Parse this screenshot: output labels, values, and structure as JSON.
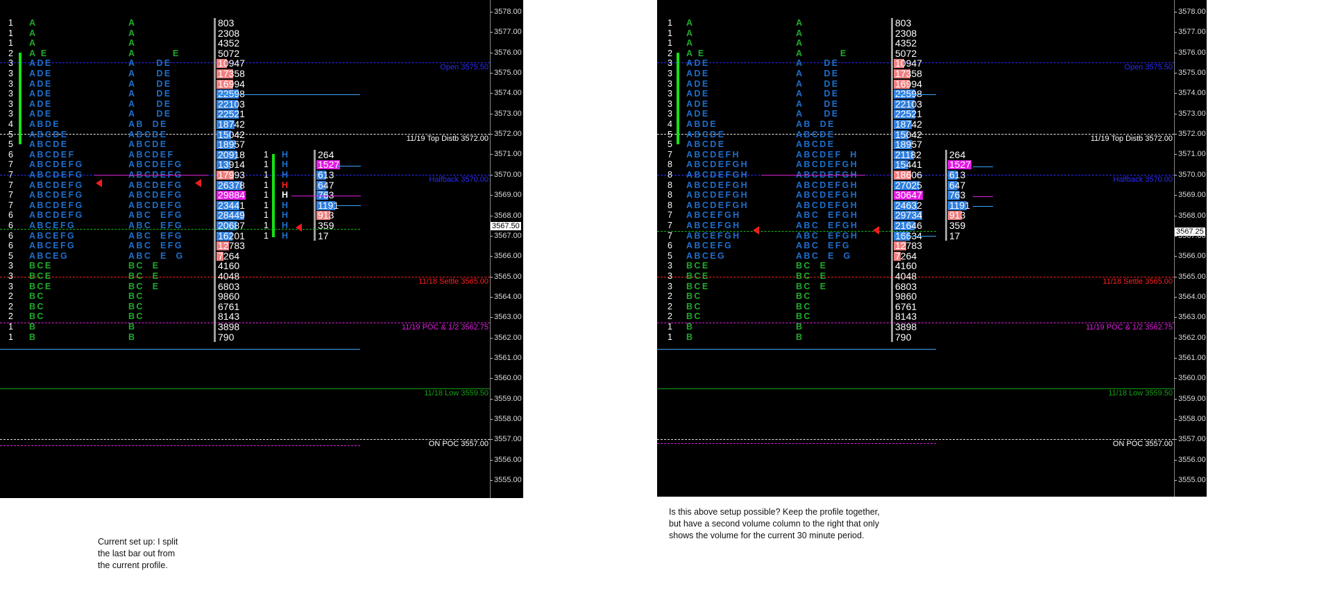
{
  "axis": {
    "labels": [
      "3578.00",
      "3577.00",
      "3576.00",
      "3575.00",
      "3574.00",
      "3573.00",
      "3572.00",
      "3571.00",
      "3570.00",
      "3569.00",
      "3568.00",
      "3567.00",
      "3566.00",
      "3565.00",
      "3564.00",
      "3563.00",
      "3562.00",
      "3561.00",
      "3560.00",
      "3559.00",
      "3558.00",
      "3557.00",
      "3556.00",
      "3555.00"
    ]
  },
  "levels": {
    "open": "Open  3575.50",
    "top_distb": "11/19 Top Distb  3572.00",
    "halfback": "Halfback  3570.00",
    "settle": "11/18 Settle  3565.00",
    "poc_half": "11/19 POC & 1/2  3562.75",
    "low": "11/18 Low  3559.50",
    "on_poc": "ON POC  3557.00"
  },
  "colors": {
    "bg": "#000000",
    "green_letters": "#1faa2a",
    "blue_letters": "#1e6fcc",
    "vol_blue": "#2f7fdf",
    "vol_salmon": "#f08080",
    "vol_magenta": "#e41ae4",
    "level_blue": "#2b2bff",
    "level_red": "#ff2020",
    "level_magenta": "#e020e0",
    "level_green": "#16a016"
  },
  "left": {
    "current_price": "3567.50",
    "profile": [
      {
        "c": "1",
        "a": "A",
        "b": "A",
        "v": "803",
        "k": "n"
      },
      {
        "c": "1",
        "a": "A",
        "b": "A",
        "v": "2308",
        "k": "n"
      },
      {
        "c": "1",
        "a": "A",
        "b": "A",
        "v": "4352",
        "k": "n"
      },
      {
        "c": "2",
        "a": "A E",
        "b": "A         E",
        "v": "5072",
        "k": "n"
      },
      {
        "c": "3",
        "a": "ADE",
        "b": "A     DE",
        "v": "10947",
        "k": "s"
      },
      {
        "c": "3",
        "a": "ADE",
        "b": "A     DE",
        "v": "17358",
        "k": "s"
      },
      {
        "c": "3",
        "a": "ADE",
        "b": "A     DE",
        "v": "16994",
        "k": "s"
      },
      {
        "c": "3",
        "a": "ADE",
        "b": "A     DE",
        "v": "22598",
        "k": "b"
      },
      {
        "c": "3",
        "a": "ADE",
        "b": "A     DE",
        "v": "22103",
        "k": "b"
      },
      {
        "c": "3",
        "a": "ADE",
        "b": "A     DE",
        "v": "22521",
        "k": "b"
      },
      {
        "c": "4",
        "a": "ABDE",
        "b": "AB  DE",
        "v": "18742",
        "k": "b"
      },
      {
        "c": "5",
        "a": "ABCDE",
        "b": "ABCDE",
        "v": "15042",
        "k": "b"
      },
      {
        "c": "5",
        "a": "ABCDE",
        "b": "ABCDE",
        "v": "18957",
        "k": "b"
      },
      {
        "c": "6",
        "a": "ABCDEF",
        "b": "ABCDEF",
        "v": "20918",
        "k": "b"
      },
      {
        "c": "7",
        "a": "ABCDEFG",
        "b": "ABCDEFG",
        "v": "13914",
        "k": "b"
      },
      {
        "c": "7",
        "a": "ABCDEFG",
        "b": "ABCDEFG",
        "v": "17993",
        "k": "s"
      },
      {
        "c": "7",
        "a": "ABCDEFG",
        "b": "ABCDEFG",
        "v": "26378",
        "k": "b"
      },
      {
        "c": "7",
        "a": "ABCDEFG",
        "b": "ABCDEFG",
        "v": "29884",
        "k": "m"
      },
      {
        "c": "7",
        "a": "ABCDEFG",
        "b": "ABCDEFG",
        "v": "23441",
        "k": "b"
      },
      {
        "c": "6",
        "a": "ABCDEFG",
        "b": "ABC  EFG",
        "v": "28449",
        "k": "b"
      },
      {
        "c": "6",
        "a": "ABCEFG",
        "b": "ABC  EFG",
        "v": "20687",
        "k": "b"
      },
      {
        "c": "6",
        "a": "ABCEFG",
        "b": "ABC  EFG",
        "v": "16201",
        "k": "b"
      },
      {
        "c": "6",
        "a": "ABCEFG",
        "b": "ABC  EFG",
        "v": "12783",
        "k": "s"
      },
      {
        "c": "5",
        "a": "ABCEG",
        "b": "ABC  E  G",
        "v": "7264",
        "k": "s"
      },
      {
        "c": "3",
        "a": "BCE",
        "b": "BC  E",
        "v": "4160",
        "k": "n"
      },
      {
        "c": "3",
        "a": "BCE",
        "b": "BC  E",
        "v": "4048",
        "k": "n"
      },
      {
        "c": "3",
        "a": "BCE",
        "b": "BC  E",
        "v": "6803",
        "k": "n"
      },
      {
        "c": "2",
        "a": "BC",
        "b": "BC",
        "v": "9860",
        "k": "n"
      },
      {
        "c": "2",
        "a": "BC",
        "b": "BC",
        "v": "6761",
        "k": "n"
      },
      {
        "c": "2",
        "a": "BC",
        "b": "BC",
        "v": "8143",
        "k": "n"
      },
      {
        "c": "1",
        "a": "B",
        "b": "B",
        "v": "3898",
        "k": "n"
      },
      {
        "c": "1",
        "a": "B",
        "b": "B",
        "v": "790",
        "k": "n"
      }
    ],
    "split_profile": [
      {
        "c": "1",
        "a": "H",
        "v": "264",
        "k": "n"
      },
      {
        "c": "1",
        "a": "H",
        "v": "1527",
        "k": "m"
      },
      {
        "c": "1",
        "a": "H",
        "v": "613",
        "k": "b"
      },
      {
        "c": "1",
        "a": "H",
        "v": "647",
        "k": "b"
      },
      {
        "c": "1",
        "a": "H",
        "v": "763",
        "k": "b"
      },
      {
        "c": "1",
        "a": "H",
        "v": "1191",
        "k": "b"
      },
      {
        "c": "1",
        "a": "H",
        "v": "913",
        "k": "s"
      },
      {
        "c": "1",
        "a": "H",
        "v": "359",
        "k": "n"
      },
      {
        "c": "1",
        "a": "H",
        "v": "17",
        "k": "n"
      }
    ]
  },
  "right": {
    "current_price": "3567.25",
    "profile": [
      {
        "c": "1",
        "a": "A",
        "b": "A",
        "v": "803",
        "k": "n"
      },
      {
        "c": "1",
        "a": "A",
        "b": "A",
        "v": "2308",
        "k": "n"
      },
      {
        "c": "1",
        "a": "A",
        "b": "A",
        "v": "4352",
        "k": "n"
      },
      {
        "c": "2",
        "a": "A E",
        "b": "A         E",
        "v": "5072",
        "k": "n"
      },
      {
        "c": "3",
        "a": "ADE",
        "b": "A     DE",
        "v": "10947",
        "k": "s"
      },
      {
        "c": "3",
        "a": "ADE",
        "b": "A     DE",
        "v": "17358",
        "k": "s"
      },
      {
        "c": "3",
        "a": "ADE",
        "b": "A     DE",
        "v": "16994",
        "k": "s"
      },
      {
        "c": "3",
        "a": "ADE",
        "b": "A     DE",
        "v": "22598",
        "k": "b"
      },
      {
        "c": "3",
        "a": "ADE",
        "b": "A     DE",
        "v": "22103",
        "k": "b"
      },
      {
        "c": "3",
        "a": "ADE",
        "b": "A     DE",
        "v": "22521",
        "k": "b"
      },
      {
        "c": "4",
        "a": "ABDE",
        "b": "AB  DE",
        "v": "18742",
        "k": "b"
      },
      {
        "c": "5",
        "a": "ABCDE",
        "b": "ABCDE",
        "v": "15042",
        "k": "b"
      },
      {
        "c": "5",
        "a": "ABCDE",
        "b": "ABCDE",
        "v": "18957",
        "k": "b"
      },
      {
        "c": "7",
        "a": "ABCDEFH",
        "b": "ABCDEF  H",
        "v": "21182",
        "k": "b"
      },
      {
        "c": "8",
        "a": "ABCDEFGH",
        "b": "ABCDEFGH",
        "v": "15441",
        "k": "b"
      },
      {
        "c": "8",
        "a": "ABCDEFGH",
        "b": "ABCDEFGH",
        "v": "18606",
        "k": "s"
      },
      {
        "c": "8",
        "a": "ABCDEFGH",
        "b": "ABCDEFGH",
        "v": "27025",
        "k": "b"
      },
      {
        "c": "8",
        "a": "ABCDEFGH",
        "b": "ABCDEFGH",
        "v": "30647",
        "k": "m"
      },
      {
        "c": "8",
        "a": "ABCDEFGH",
        "b": "ABCDEFGH",
        "v": "24632",
        "k": "b"
      },
      {
        "c": "7",
        "a": "ABCEFGH",
        "b": "ABC  EFGH",
        "v": "29734",
        "k": "b"
      },
      {
        "c": "7",
        "a": "ABCEFGH",
        "b": "ABC  EFGH",
        "v": "21646",
        "k": "b"
      },
      {
        "c": "7",
        "a": "ABCEFGH",
        "b": "ABC  EFGH",
        "v": "16634",
        "k": "b"
      },
      {
        "c": "6",
        "a": "ABCEFG",
        "b": "ABC  EFG",
        "v": "12783",
        "k": "s"
      },
      {
        "c": "5",
        "a": "ABCEG",
        "b": "ABC  E  G",
        "v": "7264",
        "k": "s"
      },
      {
        "c": "3",
        "a": "BCE",
        "b": "BC  E",
        "v": "4160",
        "k": "n"
      },
      {
        "c": "3",
        "a": "BCE",
        "b": "BC  E",
        "v": "4048",
        "k": "n"
      },
      {
        "c": "3",
        "a": "BCE",
        "b": "BC  E",
        "v": "6803",
        "k": "n"
      },
      {
        "c": "2",
        "a": "BC",
        "b": "BC",
        "v": "9860",
        "k": "n"
      },
      {
        "c": "2",
        "a": "BC",
        "b": "BC",
        "v": "6761",
        "k": "n"
      },
      {
        "c": "2",
        "a": "BC",
        "b": "BC",
        "v": "8143",
        "k": "n"
      },
      {
        "c": "1",
        "a": "B",
        "b": "B",
        "v": "3898",
        "k": "n"
      },
      {
        "c": "1",
        "a": "B",
        "b": "B",
        "v": "790",
        "k": "n"
      }
    ],
    "split_volume": [
      {
        "v": "264",
        "k": "n"
      },
      {
        "v": "1527",
        "k": "m"
      },
      {
        "v": "613",
        "k": "b"
      },
      {
        "v": "647",
        "k": "b"
      },
      {
        "v": "763",
        "k": "b"
      },
      {
        "v": "1191",
        "k": "b"
      },
      {
        "v": "913",
        "k": "s"
      },
      {
        "v": "359",
        "k": "n"
      },
      {
        "v": "17",
        "k": "n"
      }
    ]
  },
  "captions": {
    "left": "Current set up: I split\nthe last bar out from\nthe current profile.",
    "right": "Is this above setup possible? Keep the profile together,\nbut have a second volume column to the right that only\nshows the volume for the current 30 minute period."
  }
}
